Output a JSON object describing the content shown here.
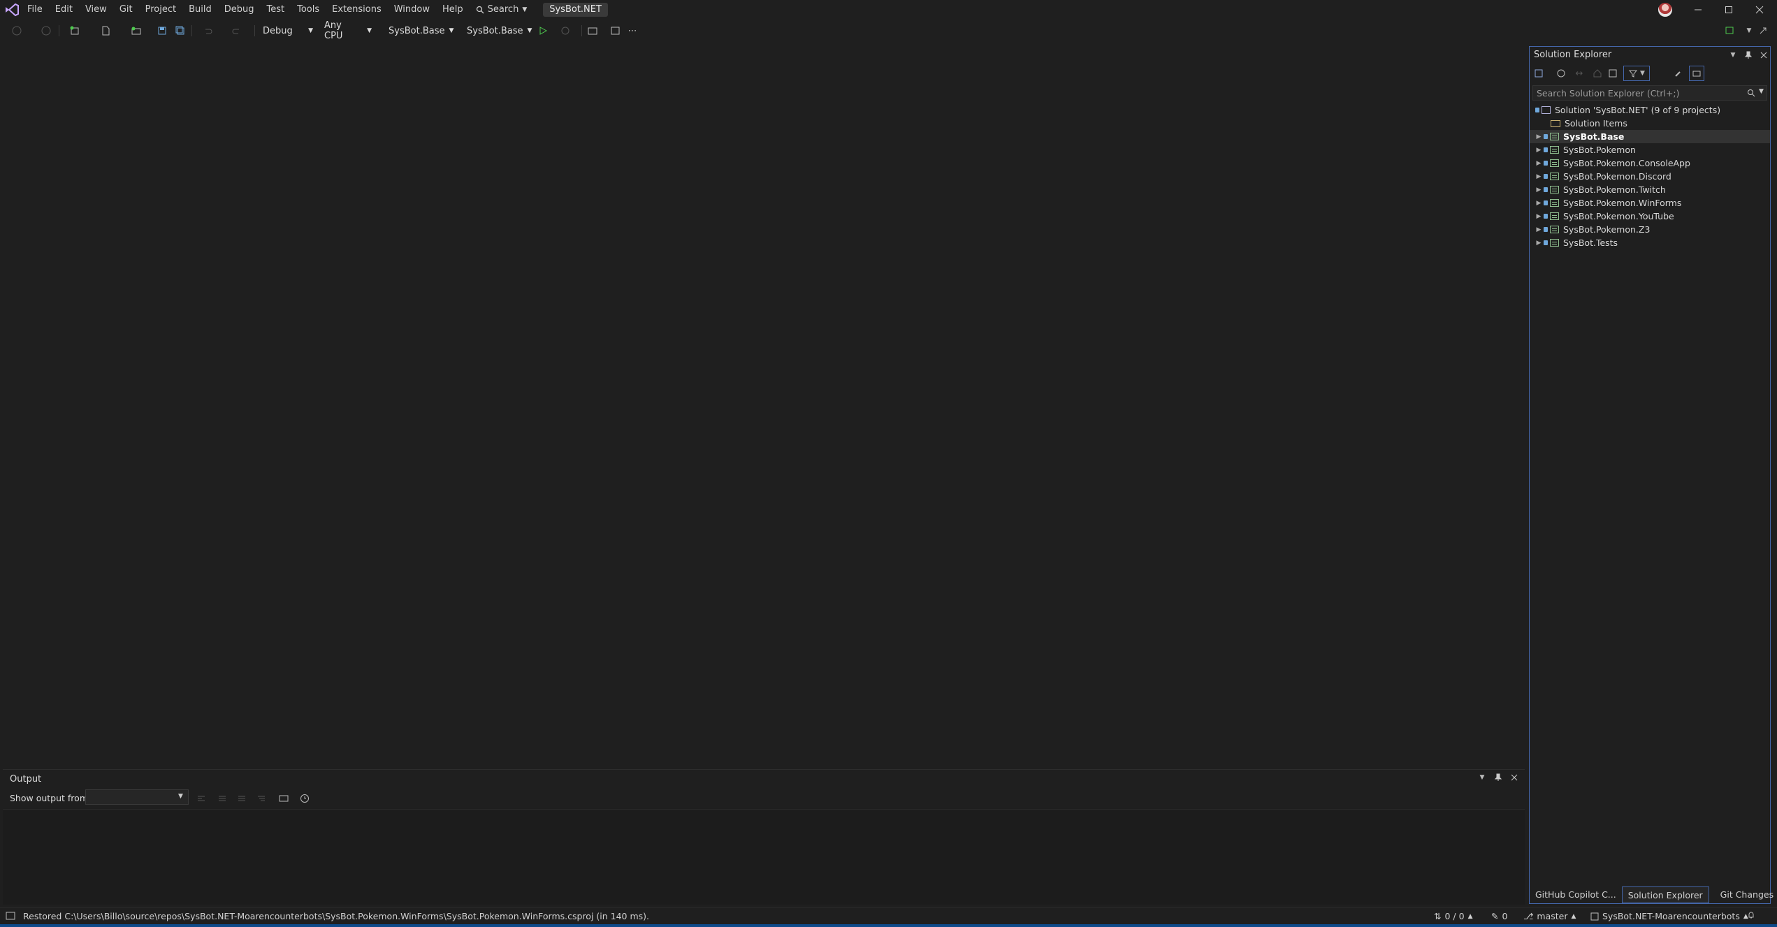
{
  "menu": {
    "items": [
      "File",
      "Edit",
      "View",
      "Git",
      "Project",
      "Build",
      "Debug",
      "Test",
      "Tools",
      "Extensions",
      "Window",
      "Help"
    ],
    "search_label": "Search",
    "solution_name": "SysBot.NET"
  },
  "toolbar": {
    "configuration": "Debug",
    "platform": "Any CPU",
    "startup_project": "SysBot.Base",
    "run_target": "SysBot.Base"
  },
  "solution_explorer": {
    "title": "Solution Explorer",
    "search_placeholder": "Search Solution Explorer (Ctrl+;)",
    "solution_label": "Solution 'SysBot.NET' (9 of 9 projects)",
    "solution_items": "Solution Items",
    "projects": [
      "SysBot.Base",
      "SysBot.Pokemon",
      "SysBot.Pokemon.ConsoleApp",
      "SysBot.Pokemon.Discord",
      "SysBot.Pokemon.Twitch",
      "SysBot.Pokemon.WinForms",
      "SysBot.Pokemon.YouTube",
      "SysBot.Pokemon.Z3",
      "SysBot.Tests"
    ],
    "selected_project": "SysBot.Base",
    "tabs": [
      "GitHub Copilot C...",
      "Solution Explorer",
      "Git Changes"
    ]
  },
  "output": {
    "title": "Output",
    "show_output_from_label": "Show output from:",
    "source_value": ""
  },
  "status": {
    "message": "Restored C:\\Users\\Billo\\source\\repos\\SysBot.NET-Moarencounterbots\\SysBot.Pokemon.WinForms\\SysBot.Pokemon.WinForms.csproj (in 140 ms).",
    "sync": "0 / 0",
    "pending_changes": "0",
    "branch": "master",
    "repo": "SysBot.NET-Moarencounterbots"
  },
  "colors": {
    "background": "#1f1f1f",
    "accent": "#4466aa",
    "run_green": "#4ec94e",
    "status_strip": "#0e4a8a"
  }
}
